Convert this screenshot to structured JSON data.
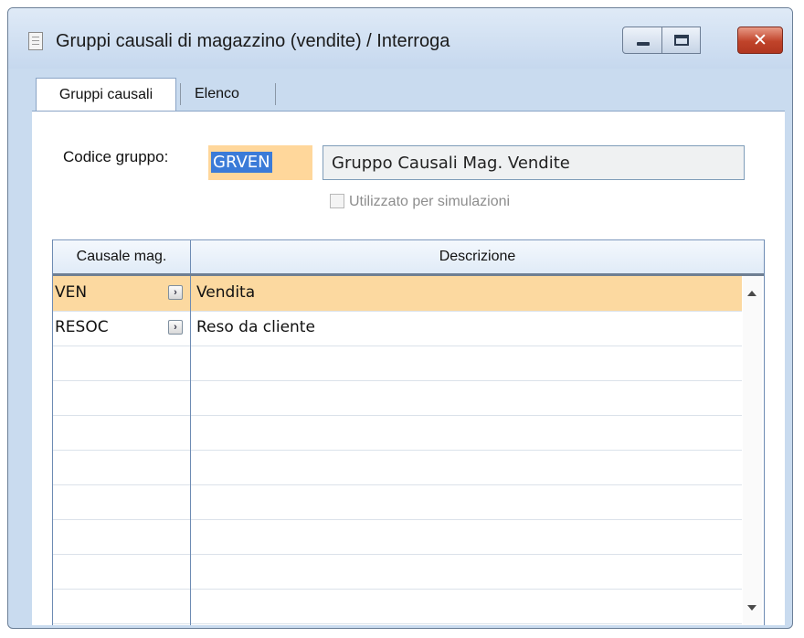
{
  "window": {
    "title": "Gruppi causali di magazzino (vendite) / Interroga"
  },
  "tabs": [
    {
      "label": "Gruppi causali",
      "active": true
    },
    {
      "label": "Elenco",
      "active": false
    }
  ],
  "form": {
    "codice_label": "Codice gruppo:",
    "codice_value": "GRVEN",
    "descrizione_value": "Gruppo Causali Mag. Vendite",
    "simulazioni_label": "Utilizzato per simulazioni",
    "simulazioni_checked": false
  },
  "grid": {
    "columns": [
      "Causale mag.",
      "Descrizione"
    ],
    "rows": [
      {
        "causale": "VEN",
        "descrizione": "Vendita",
        "selected": true
      },
      {
        "causale": "RESOC",
        "descrizione": "Reso da cliente",
        "selected": false
      }
    ],
    "empty_rows": 8
  },
  "colors": {
    "selected_row": "#fcd9a0",
    "field_focus": "#ffd79b",
    "text_selection": "#3b7bd8",
    "close_button": "#c0432a"
  }
}
